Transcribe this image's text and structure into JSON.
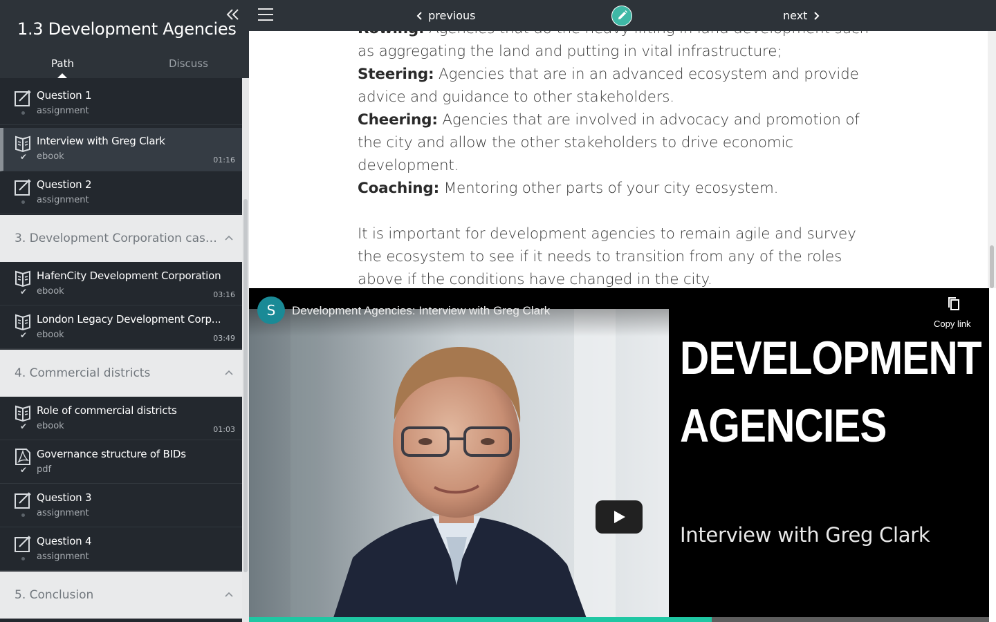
{
  "sidebar": {
    "course_title": "1.3 Development Agencies",
    "tabs": {
      "path": "Path",
      "discuss": "Discuss"
    },
    "items": [
      {
        "title": "Question 1",
        "type": "assignment",
        "icon": "assignment-icon",
        "status": "incomplete",
        "duration": ""
      },
      {
        "title": "Interview with Greg Clark",
        "type": "ebook",
        "icon": "ebook-icon",
        "status": "complete",
        "duration": "01:16"
      },
      {
        "title": "Question 2",
        "type": "assignment",
        "icon": "assignment-icon",
        "status": "incomplete",
        "duration": ""
      },
      {
        "title": "HafenCity Development Corporation",
        "type": "ebook",
        "icon": "ebook-icon",
        "status": "complete",
        "duration": "03:16"
      },
      {
        "title": "London Legacy Development Corp...",
        "type": "ebook",
        "icon": "ebook-icon",
        "status": "complete",
        "duration": "03:49"
      },
      {
        "title": "Role of commercial districts",
        "type": "ebook",
        "icon": "ebook-icon",
        "status": "complete",
        "duration": "01:03"
      },
      {
        "title": "Governance structure of BIDs",
        "type": "pdf",
        "icon": "pdf-icon",
        "status": "complete",
        "duration": ""
      },
      {
        "title": "Question 3",
        "type": "assignment",
        "icon": "assignment-icon",
        "status": "incomplete",
        "duration": ""
      },
      {
        "title": "Question 4",
        "type": "assignment",
        "icon": "assignment-icon",
        "status": "incomplete",
        "duration": ""
      }
    ],
    "sections": [
      {
        "label": "3. Development Corporation case s..."
      },
      {
        "label": "4. Commercial districts"
      },
      {
        "label": "5. Conclusion"
      }
    ]
  },
  "nav": {
    "previous": "previous",
    "next": "next"
  },
  "content": {
    "rowing_label": "Rowing:",
    "rowing_text": "Agencies that do the heavy lifting in land development such as aggregating the land and putting in vital infrastructure;",
    "steering_label": "Steering:",
    "steering_text": "Agencies that are in an advanced ecosystem and provide advice and guidance to other stakeholders.",
    "cheering_label": "Cheering:",
    "cheering_text": "Agencies that are involved in advocacy and promotion of the city and allow the other stakeholders to drive economic development.",
    "coaching_label": "Coaching:",
    "coaching_text": "Mentoring other parts of your city ecosystem.",
    "paragraph": "It is important for development agencies to remain agile and survey the ecosystem to see if it needs to transition from any of the roles above if the conditions have changed in the city."
  },
  "video": {
    "channel_initial": "S",
    "title": "Development Agencies: Interview with Greg Clark",
    "copy_link": "Copy link",
    "thumb_title_line1": "DEVELOPMENT",
    "thumb_title_line2": "AGENCIES",
    "thumb_subtitle": "Interview with Greg Clark",
    "progress_fraction": 0.625,
    "accent_color": "#1fc7a3"
  },
  "colors": {
    "header_bg": "#2d3339",
    "sidebar_item_bg": "#23282e",
    "section_bg": "#e9eaeb",
    "edit_button": "#3fb8a6"
  }
}
